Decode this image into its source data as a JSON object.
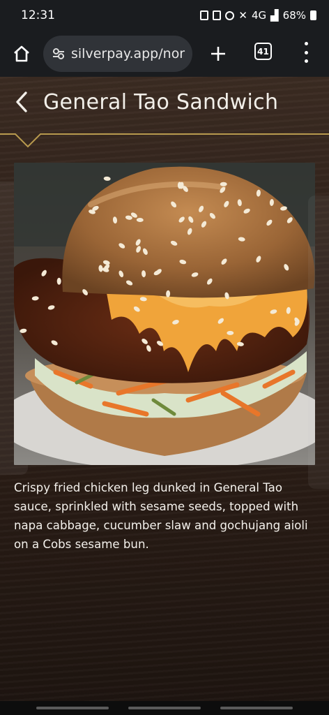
{
  "status_bar": {
    "time": "12:31",
    "network": "4G",
    "battery": "68%"
  },
  "browser": {
    "url": "silverpay.app/nor",
    "tab_count": "41",
    "icons": [
      "home-icon",
      "site-settings-icon",
      "new-tab-icon",
      "tab-switcher-icon",
      "more-icon"
    ]
  },
  "page": {
    "title": "General Tao Sandwich",
    "description": "Crispy fried chicken leg dunked in General Tao sauce, sprinkled with sesame seeds, topped with napa cabbage, cucumber slaw and gochujang aioli on a Cobs sesame bun.",
    "accent_color": "#b89a4e"
  }
}
